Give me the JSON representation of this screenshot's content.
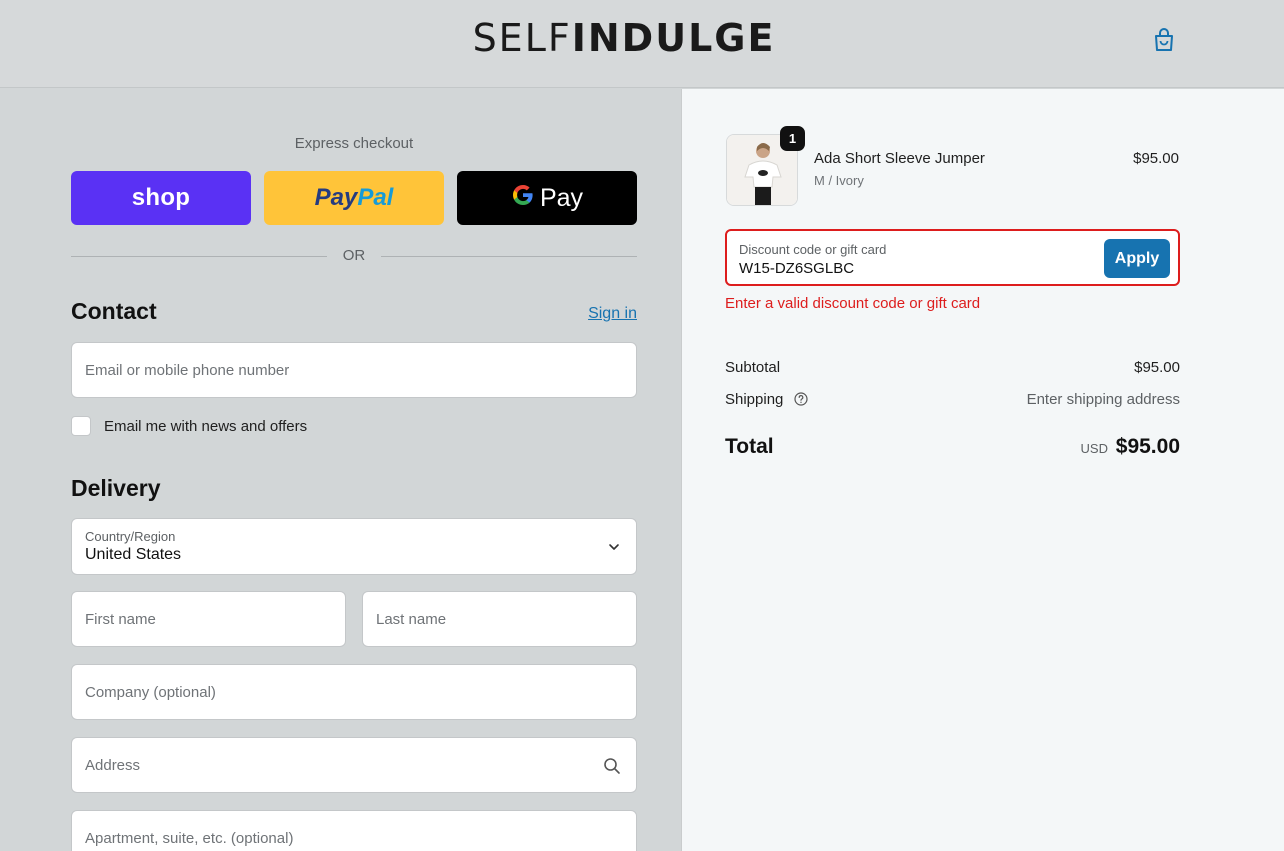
{
  "header": {
    "brand_left": "SELF",
    "brand_right": "INDULGE",
    "cart_icon": "shopping-bag-icon"
  },
  "express": {
    "label": "Express checkout",
    "shop_label": "shop",
    "paypal_label_1": "Pay",
    "paypal_label_2": "Pal",
    "gpay_g": "G",
    "gpay_label": "Pay",
    "or_label": "OR"
  },
  "contact": {
    "title": "Contact",
    "sign_in": "Sign in",
    "email_placeholder": "Email or mobile phone number",
    "newsletter_label": "Email me with news and offers"
  },
  "delivery": {
    "title": "Delivery",
    "country_label": "Country/Region",
    "country_value": "United States",
    "first_name_placeholder": "First name",
    "last_name_placeholder": "Last name",
    "company_placeholder": "Company (optional)",
    "address_placeholder": "Address",
    "apartment_placeholder": "Apartment, suite, etc. (optional)"
  },
  "order": {
    "quantity": "1",
    "product_name": "Ada Short Sleeve Jumper",
    "variant": "M / Ivory",
    "price": "$95.00",
    "discount_label": "Discount code or gift card",
    "discount_value": "W15-DZ6SGLBC",
    "apply_label": "Apply",
    "discount_error": "Enter a valid discount code or gift card",
    "subtotal_label": "Subtotal",
    "subtotal_value": "$95.00",
    "shipping_label": "Shipping",
    "shipping_value": "Enter shipping address",
    "total_label": "Total",
    "currency": "USD",
    "total_value": "$95.00"
  },
  "colors": {
    "shop_purple": "#5a31f4",
    "paypal_yellow": "#ffc439",
    "link_blue": "#1773b0",
    "error_red": "#dd1d1d"
  }
}
